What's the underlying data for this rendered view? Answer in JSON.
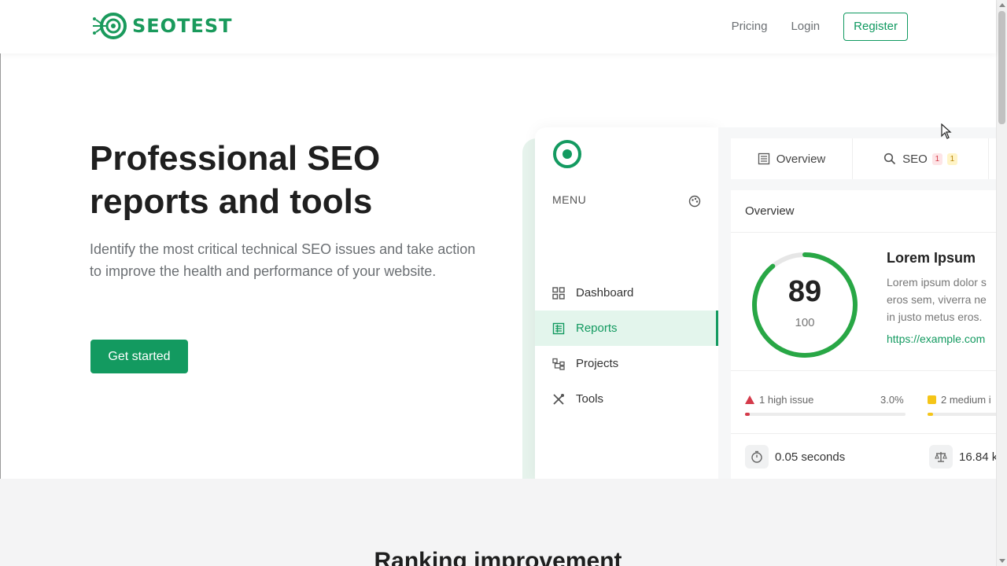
{
  "brand": {
    "name": "SEOTEST",
    "color": "#1a9a5c"
  },
  "nav": {
    "pricing": "Pricing",
    "login": "Login",
    "register": "Register"
  },
  "hero": {
    "title": "Professional SEO reports and tools",
    "description": "Identify the most critical technical SEO issues and take action to improve the health and performance of your website.",
    "cta": "Get started"
  },
  "dashboard": {
    "menu_title": "MENU",
    "menu": [
      {
        "label": "Dashboard",
        "icon": "grid-icon"
      },
      {
        "label": "Reports",
        "icon": "report-icon",
        "active": true
      },
      {
        "label": "Projects",
        "icon": "projects-icon"
      },
      {
        "label": "Tools",
        "icon": "tools-icon"
      }
    ],
    "tabs": [
      {
        "label": "Overview",
        "icon": "overview-icon"
      },
      {
        "label": "SEO",
        "icon": "search-icon",
        "badge_high": "1",
        "badge_medium": "1"
      }
    ],
    "card_title": "Overview",
    "score": "89",
    "score_max": "100",
    "score_fraction": 0.89,
    "site_title": "Lorem Ipsum",
    "site_desc": "Lorem ipsum dolor s\neros sem, viverra ne\nin justo metus eros.",
    "site_link": "https://example.com",
    "issues": {
      "high_label": "1 high issue",
      "high_pct": "3.0%",
      "high_fraction": 0.03,
      "medium_label": "2 medium i",
      "medium_fraction": 0.06
    },
    "stats": {
      "load_time": "0.05 seconds",
      "size": "16.84 k"
    },
    "accent": "#139a60",
    "high_color": "#d43a4a",
    "medium_color": "#f5c518"
  },
  "lower": {
    "title": "Ranking improvement"
  }
}
